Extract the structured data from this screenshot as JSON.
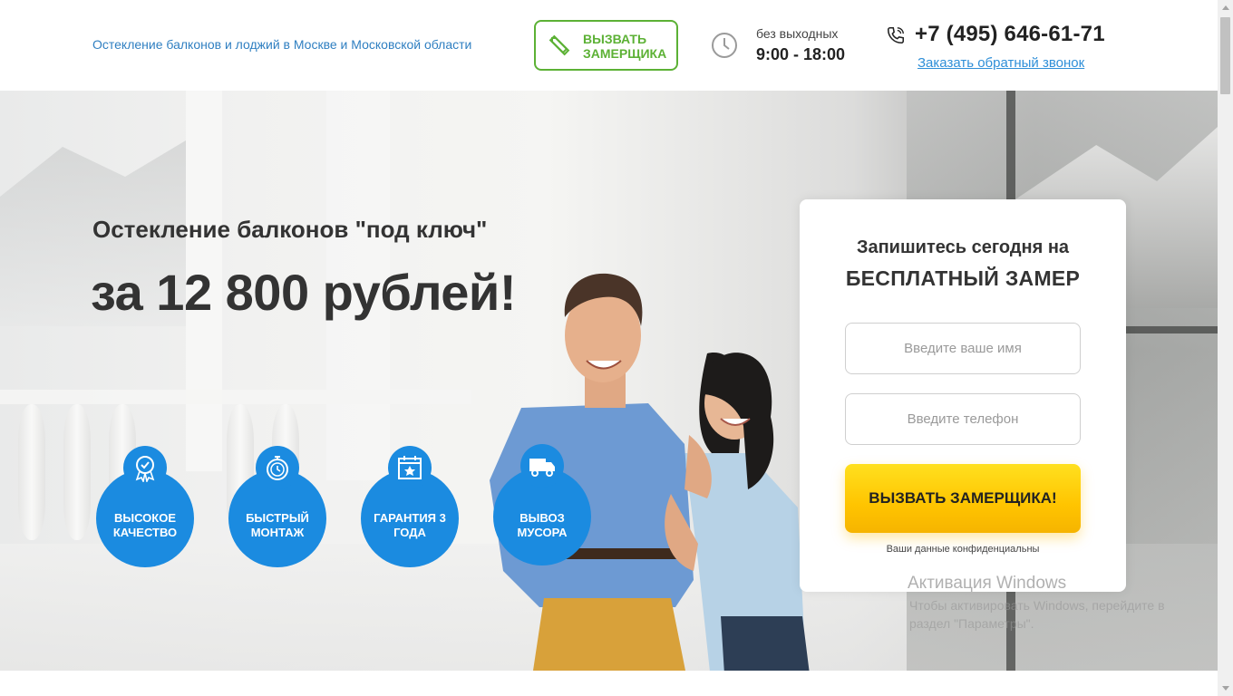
{
  "header": {
    "tagline": "Остекление балконов и лоджий в Москве и Московской области",
    "measure_button_label": "ВЫЗВАТЬ ЗАМЕРЩИКА",
    "hours_note": "без выходных",
    "hours": "9:00 - 18:00",
    "phone": "+7 (495) 646-61-71",
    "callback_link": "Заказать обратный звонок"
  },
  "hero": {
    "title": "Остекление балконов \"под ключ\"",
    "price": "за 12 800 рублей!"
  },
  "features": [
    {
      "label": "ВЫСОКОЕ КАЧЕСТВО",
      "icon": "quality-badge-icon"
    },
    {
      "label": "БЫСТРЫЙ МОНТАЖ",
      "icon": "stopwatch-icon"
    },
    {
      "label": "ГАРАНТИЯ 3 ГОДА",
      "icon": "calendar-icon"
    },
    {
      "label": "ВЫВОЗ МУСОРА",
      "icon": "truck-icon"
    }
  ],
  "form": {
    "title_line1": "Запишитесь сегодня на",
    "title_line2": "БЕСПЛАТНЫЙ ЗАМЕР",
    "name_placeholder": "Введите ваше имя",
    "phone_placeholder": "Введите телефон",
    "submit_label": "ВЫЗВАТЬ ЗАМЕРЩИКА!",
    "privacy_note": "Ваши данные конфиденциальны"
  },
  "watermark": {
    "title": "Активация Windows",
    "text": "Чтобы активировать Windows, перейдите в раздел \"Параметры\"."
  },
  "colors": {
    "accent_blue": "#1b8be0",
    "accent_green": "#5cb135",
    "cta_yellow": "#ffc400",
    "link_blue": "#2f8fd8"
  }
}
